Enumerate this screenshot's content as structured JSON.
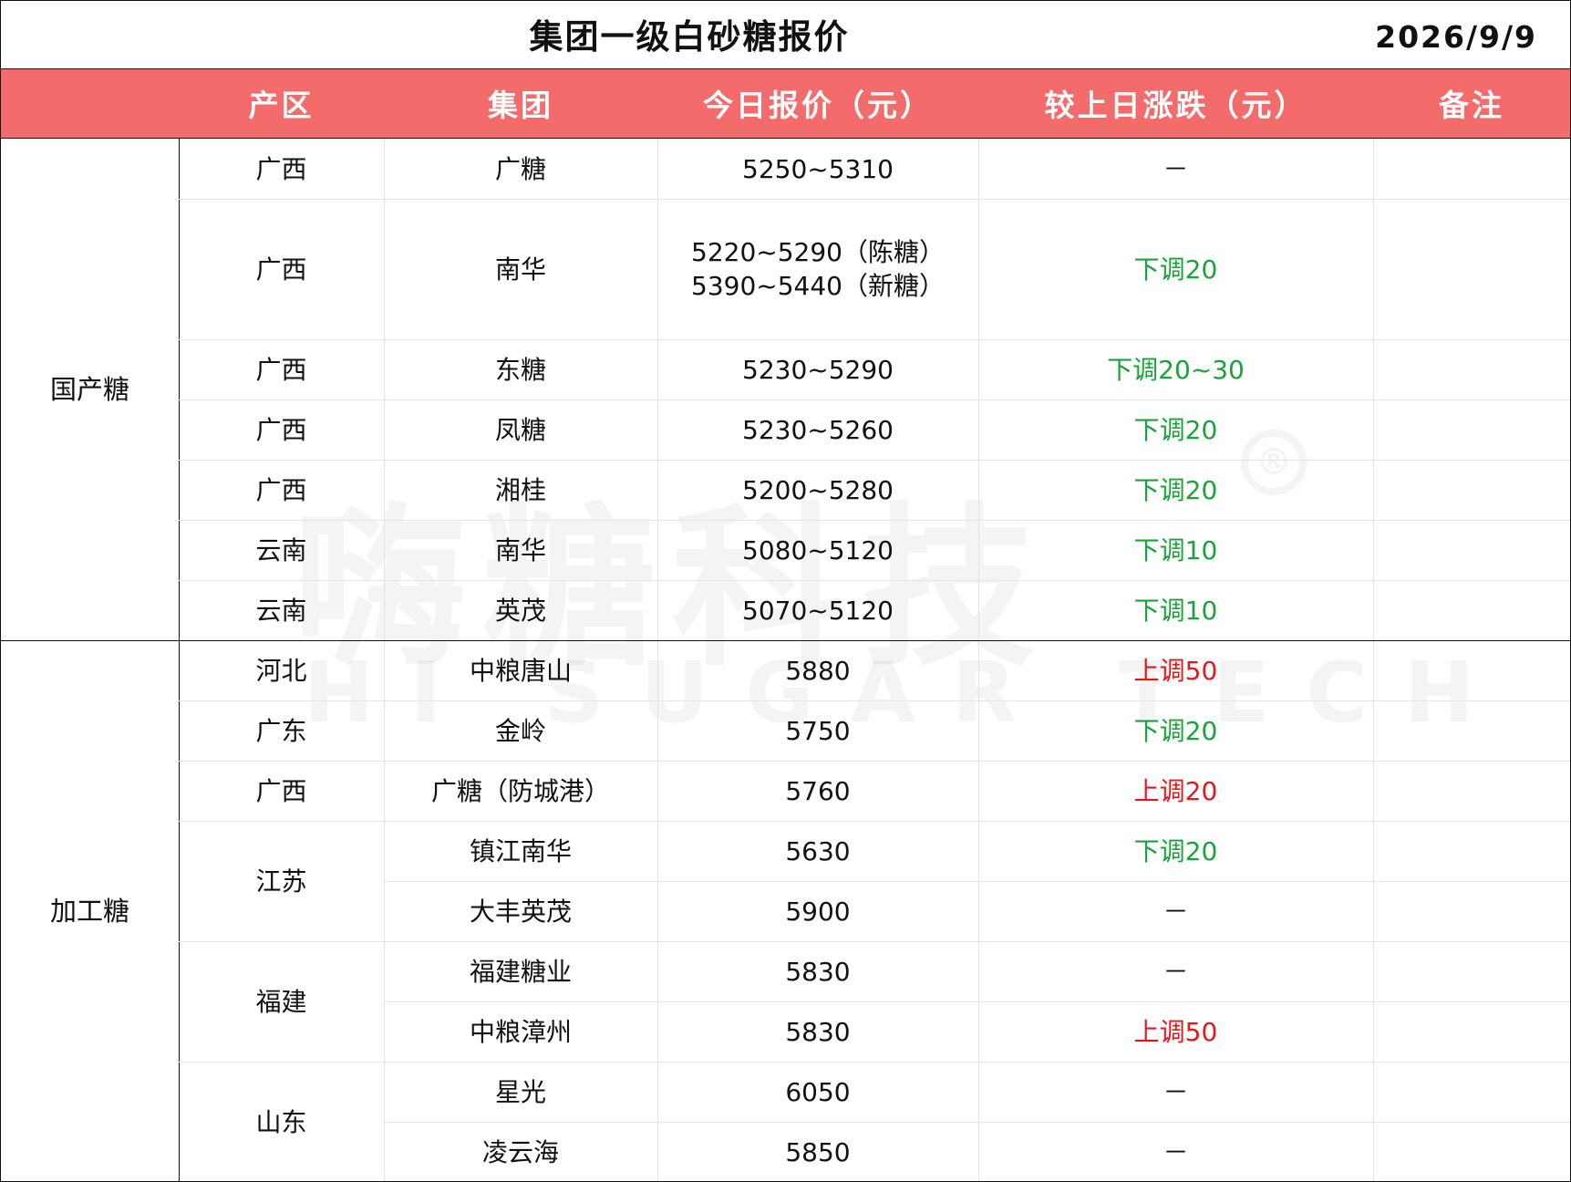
{
  "title": "集团一级白砂糖报价",
  "date": "2026/9/9",
  "colors": {
    "header_bg": "#f46b6b",
    "down": "#1aa33a",
    "up": "#e8161b"
  },
  "headers": [
    "产区",
    "集团",
    "今日报价（元）",
    "较上日涨跌（元）",
    "备注"
  ],
  "categories": [
    {
      "label": "国产糖",
      "rows": 7
    },
    {
      "label": "加工糖",
      "rows": 9
    }
  ],
  "rows": [
    {
      "region": "广西",
      "group": "广糖",
      "price": "5250~5310",
      "change": "－",
      "dir": "none"
    },
    {
      "region": "广西",
      "group": "南华",
      "price": "5220~5290（陈糖）\n5390~5440（新糖）",
      "change": "下调20",
      "dir": "down"
    },
    {
      "region": "广西",
      "group": "东糖",
      "price": "5230~5290",
      "change": "下调20~30",
      "dir": "down"
    },
    {
      "region": "广西",
      "group": "凤糖",
      "price": "5230~5260",
      "change": "下调20",
      "dir": "down"
    },
    {
      "region": "广西",
      "group": "湘桂",
      "price": "5200~5280",
      "change": "下调20",
      "dir": "down"
    },
    {
      "region": "云南",
      "group": "南华",
      "price": "5080~5120",
      "change": "下调10",
      "dir": "down"
    },
    {
      "region": "云南",
      "group": "英茂",
      "price": "5070~5120",
      "change": "下调10",
      "dir": "down"
    },
    {
      "region": "河北",
      "group": "中粮唐山",
      "price": "5880",
      "change": "上调50",
      "dir": "up"
    },
    {
      "region": "广东",
      "group": "金岭",
      "price": "5750",
      "change": "下调20",
      "dir": "down"
    },
    {
      "region": "广西",
      "group": "广糖（防城港）",
      "price": "5760",
      "change": "上调20",
      "dir": "up"
    },
    {
      "region": "江苏",
      "group": "镇江南华",
      "price": "5630",
      "change": "下调20",
      "dir": "down"
    },
    {
      "region": "",
      "group": "大丰英茂",
      "price": "5900",
      "change": "－",
      "dir": "none"
    },
    {
      "region": "福建",
      "group": "福建糖业",
      "price": "5830",
      "change": "－",
      "dir": "none"
    },
    {
      "region": "",
      "group": "中粮漳州",
      "price": "5830",
      "change": "上调50",
      "dir": "up"
    },
    {
      "region": "山东",
      "group": "星光",
      "price": "6050",
      "change": "－",
      "dir": "none"
    },
    {
      "region": "",
      "group": "凌云海",
      "price": "5850",
      "change": "－",
      "dir": "none"
    }
  ],
  "region_spans": [
    {
      "region": "江苏",
      "start": 10,
      "span": 2
    },
    {
      "region": "福建",
      "start": 12,
      "span": 2
    },
    {
      "region": "山东",
      "start": 14,
      "span": 2
    }
  ],
  "watermark": {
    "cn": "嗨糖科技",
    "en": "HI SUGAR TECH",
    "reg": "®"
  }
}
